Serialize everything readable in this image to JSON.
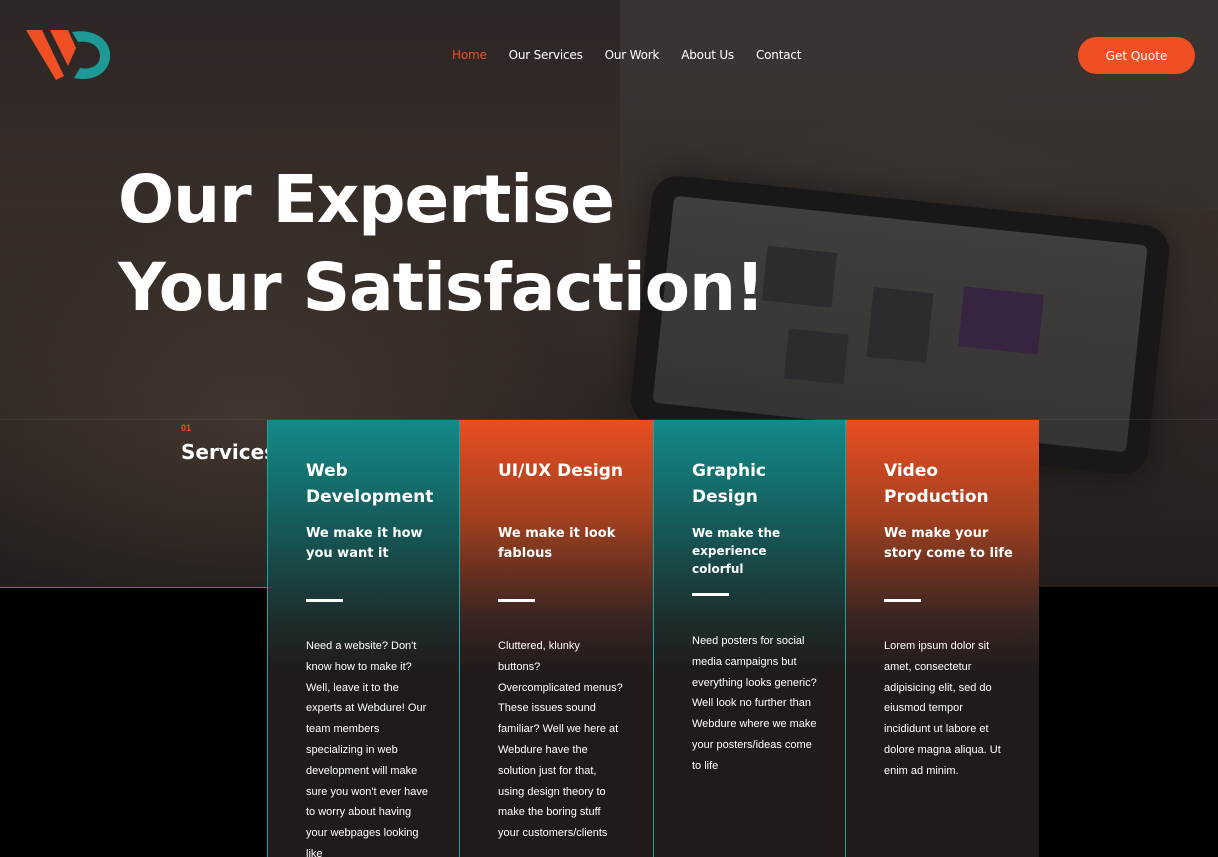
{
  "nav": {
    "items": [
      {
        "label": "Home",
        "active": true
      },
      {
        "label": "Our Services",
        "active": false
      },
      {
        "label": "Our Work",
        "active": false
      },
      {
        "label": "About Us",
        "active": false
      },
      {
        "label": "Contact",
        "active": false
      }
    ],
    "cta_label": "Get Quote"
  },
  "hero": {
    "line1": "Our Expertise",
    "line2": "Your Satisfaction!"
  },
  "services": {
    "number": "01",
    "heading": "Services",
    "cards": [
      {
        "title": "Web Development",
        "tagline": "We make it how you want it",
        "description": "Need a website? Don't know how to make it? Well, leave it to the experts at Webdure! Our team members specializing in web development will make sure you won't ever have to worry about having your webpages looking like",
        "style": "teal"
      },
      {
        "title": "UI/UX Design",
        "tagline": "We make it look fablous",
        "description": "Cluttered, klunky buttons? Overcomplicated menus? These issues sound familiar? Well we here at Webdure have the solution just for that, using design theory to make the boring stuff your customers/clients",
        "style": "orange"
      },
      {
        "title": "Graphic Design",
        "tagline": "We make the experience colorful",
        "description": "Need posters for social media campaigns but everything looks generic? Well look no further than Webdure where we make your posters/ideas come to life",
        "style": "teal"
      },
      {
        "title": "Video Production",
        "tagline": "We make your story come to life",
        "description": "Lorem ipsum dolor sit amet, consectetur adipisicing elit, sed do eiusmod tempor incididunt ut labore et dolore magna aliqua. Ut enim ad minim.",
        "style": "orange"
      }
    ]
  },
  "colors": {
    "accent": "#f04f24",
    "teal": "#138a8a",
    "dark": "#201b1a"
  },
  "icons": {
    "logo": "vd-logo-icon"
  }
}
